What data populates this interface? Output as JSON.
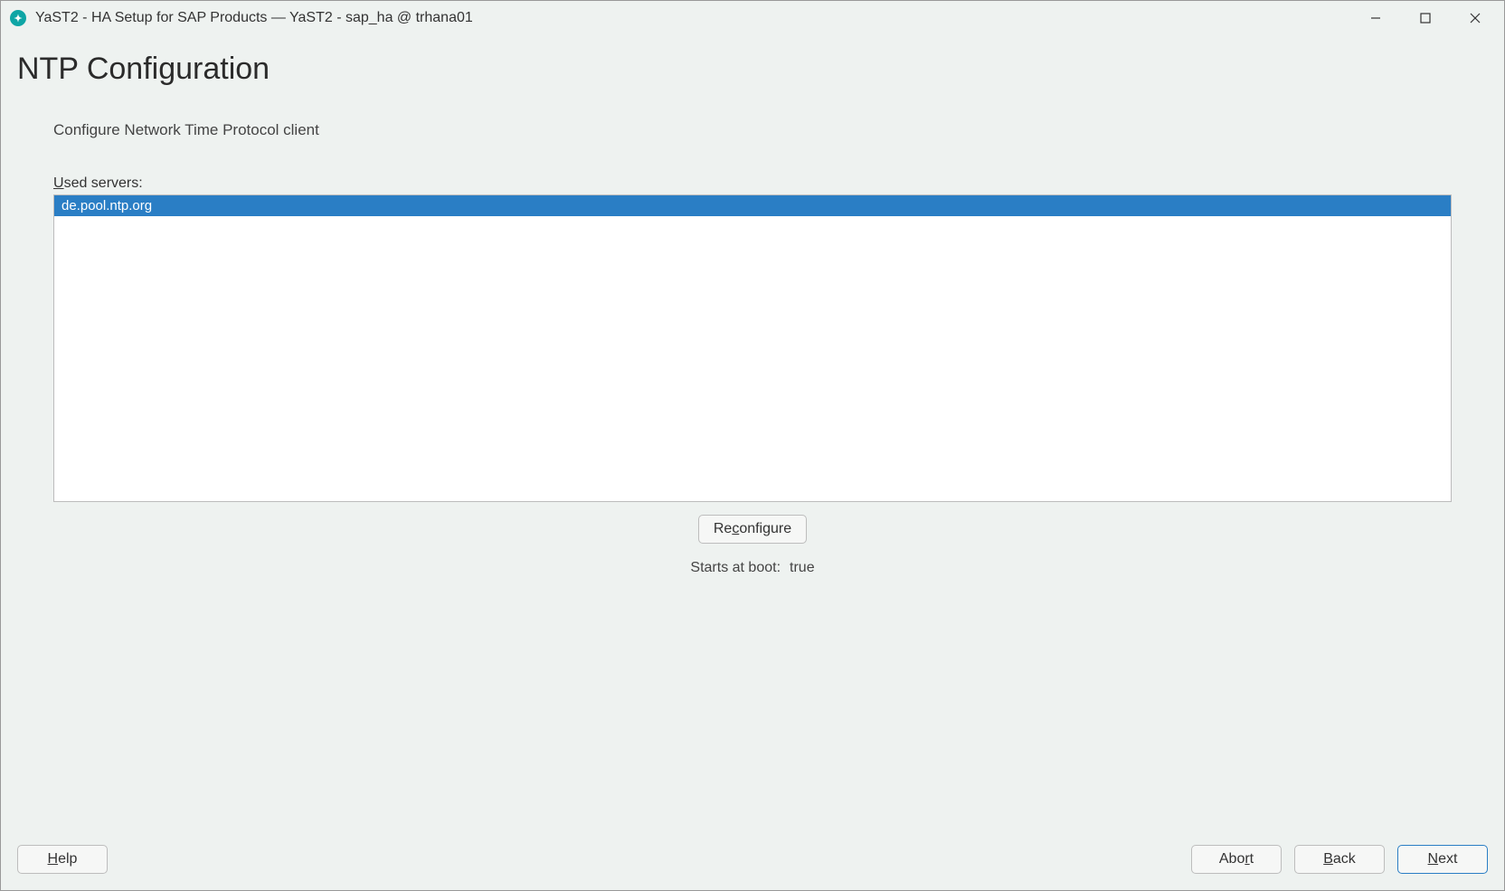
{
  "window": {
    "title": "YaST2 - HA Setup for SAP Products — YaST2 - sap_ha @ trhana01"
  },
  "page": {
    "heading": "NTP Configuration",
    "subheading": "Configure Network Time Protocol client",
    "servers_label_pre": "U",
    "servers_label_rest": "sed servers:",
    "servers": [
      "de.pool.ntp.org"
    ],
    "reconfigure_pre": "Re",
    "reconfigure_ul": "c",
    "reconfigure_post": "onfigure",
    "starts_at_boot_label": "Starts at boot:",
    "starts_at_boot_value": "true"
  },
  "footer": {
    "help_pre": "",
    "help_ul": "H",
    "help_post": "elp",
    "abort_pre": "Abo",
    "abort_ul": "r",
    "abort_post": "t",
    "back_pre": "",
    "back_ul": "B",
    "back_post": "ack",
    "next_pre": "",
    "next_ul": "N",
    "next_post": "ext"
  }
}
